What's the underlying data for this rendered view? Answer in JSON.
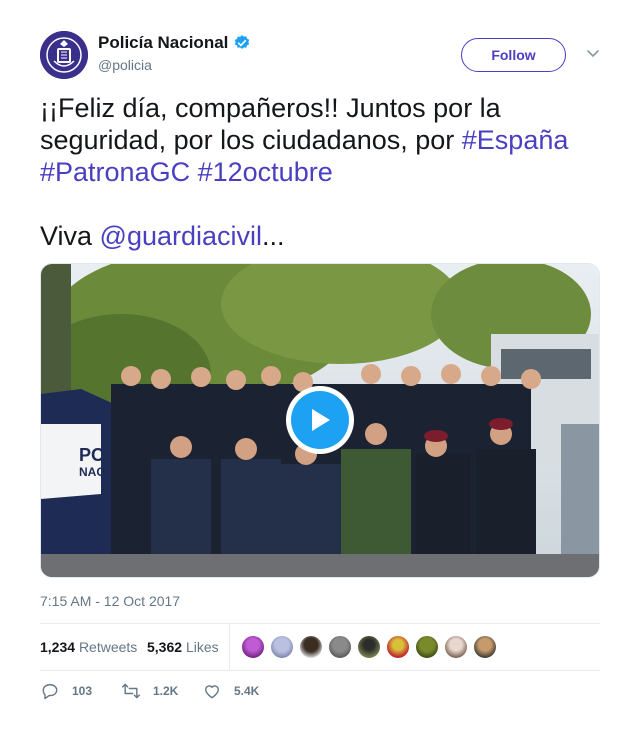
{
  "author": {
    "display_name": "Policía Nacional",
    "handle": "@policia",
    "verified_icon": "verified-badge-icon",
    "avatar_icon": "police-shield-logo"
  },
  "header": {
    "follow_label": "Follow",
    "more_icon": "chevron-down-icon"
  },
  "tweet": {
    "text_part1": "¡¡Feliz día, compañeros!! Juntos por la seguridad, por los ciudadanos, por ",
    "hashtag1": "#España",
    "hashtag2": "#PatronaGC",
    "hashtag3": "#12octubre",
    "viva": "Viva ",
    "mention": "@guardiacivil",
    "ellipsis": "..."
  },
  "media": {
    "play_icon": "play-icon"
  },
  "timestamp": "7:15 AM - 12 Oct 2017",
  "stats": {
    "retweets_count": "1,234",
    "retweets_label": "Retweets",
    "likes_count": "5,362",
    "likes_label": "Likes",
    "liker_count": 9
  },
  "actions": {
    "reply_count": "103",
    "retweet_count": "1.2K",
    "like_count": "5.4K"
  },
  "colors": {
    "link": "#4a3fc1",
    "verified": "#1da1f2",
    "muted": "#657786"
  }
}
